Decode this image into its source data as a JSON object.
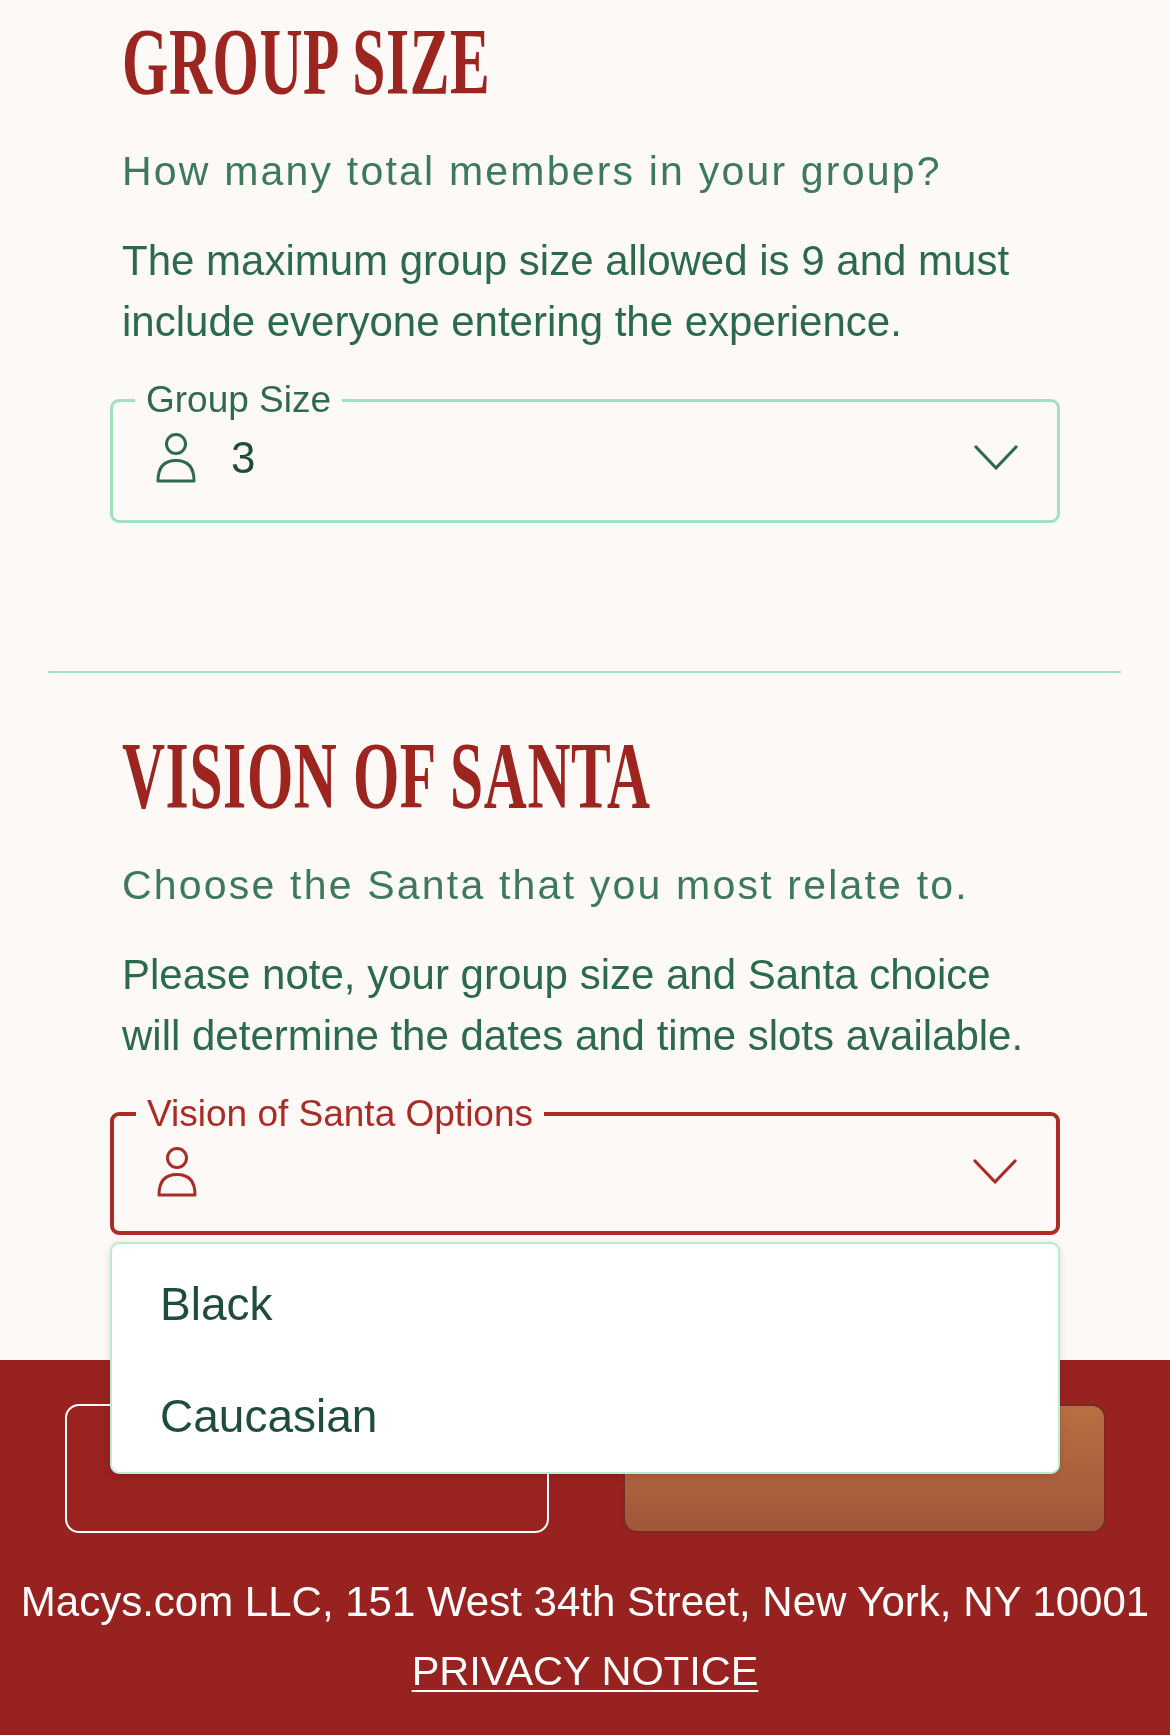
{
  "sections": [
    {
      "title": "GROUP SIZE",
      "prompt": "How many total members in your group?",
      "note": "The maximum group size allowed is 9 and must include everyone entering the experience.",
      "field": {
        "label": "Group Size",
        "value": "3",
        "focused": false
      }
    },
    {
      "title": "VISION OF SANTA",
      "prompt": "Choose the Santa that you most relate to.",
      "note": "Please note, your group size and Santa choice will determine the dates and time slots available.",
      "field": {
        "label": "Vision of Santa Options",
        "focused": true,
        "options": [
          {
            "label": "Black",
            "selected": false
          },
          {
            "label": "Caucasian",
            "selected": false
          }
        ]
      }
    }
  ],
  "buttons": [
    {
      "kind": "secondary",
      "disabled": false
    },
    {
      "kind": "primary",
      "disabled": true
    }
  ],
  "footer": {
    "address": "Macys.com LLC, 151 West 34th Street, New York, NY 10001",
    "link": "PRIVACY NOTICE"
  }
}
